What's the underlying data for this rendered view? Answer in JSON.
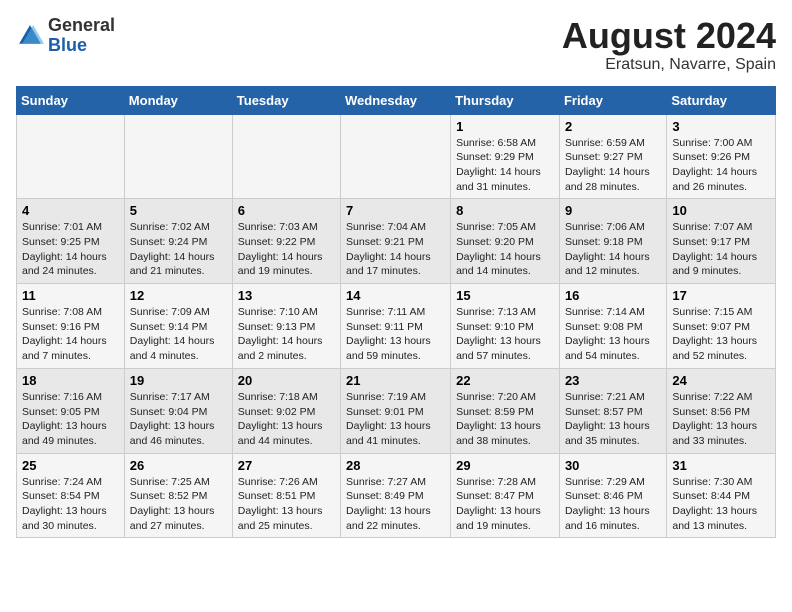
{
  "header": {
    "logo_general": "General",
    "logo_blue": "Blue",
    "month_year": "August 2024",
    "location": "Eratsun, Navarre, Spain"
  },
  "weekdays": [
    "Sunday",
    "Monday",
    "Tuesday",
    "Wednesday",
    "Thursday",
    "Friday",
    "Saturday"
  ],
  "weeks": [
    [
      {
        "day": "",
        "info": ""
      },
      {
        "day": "",
        "info": ""
      },
      {
        "day": "",
        "info": ""
      },
      {
        "day": "",
        "info": ""
      },
      {
        "day": "1",
        "info": "Sunrise: 6:58 AM\nSunset: 9:29 PM\nDaylight: 14 hours\nand 31 minutes."
      },
      {
        "day": "2",
        "info": "Sunrise: 6:59 AM\nSunset: 9:27 PM\nDaylight: 14 hours\nand 28 minutes."
      },
      {
        "day": "3",
        "info": "Sunrise: 7:00 AM\nSunset: 9:26 PM\nDaylight: 14 hours\nand 26 minutes."
      }
    ],
    [
      {
        "day": "4",
        "info": "Sunrise: 7:01 AM\nSunset: 9:25 PM\nDaylight: 14 hours\nand 24 minutes."
      },
      {
        "day": "5",
        "info": "Sunrise: 7:02 AM\nSunset: 9:24 PM\nDaylight: 14 hours\nand 21 minutes."
      },
      {
        "day": "6",
        "info": "Sunrise: 7:03 AM\nSunset: 9:22 PM\nDaylight: 14 hours\nand 19 minutes."
      },
      {
        "day": "7",
        "info": "Sunrise: 7:04 AM\nSunset: 9:21 PM\nDaylight: 14 hours\nand 17 minutes."
      },
      {
        "day": "8",
        "info": "Sunrise: 7:05 AM\nSunset: 9:20 PM\nDaylight: 14 hours\nand 14 minutes."
      },
      {
        "day": "9",
        "info": "Sunrise: 7:06 AM\nSunset: 9:18 PM\nDaylight: 14 hours\nand 12 minutes."
      },
      {
        "day": "10",
        "info": "Sunrise: 7:07 AM\nSunset: 9:17 PM\nDaylight: 14 hours\nand 9 minutes."
      }
    ],
    [
      {
        "day": "11",
        "info": "Sunrise: 7:08 AM\nSunset: 9:16 PM\nDaylight: 14 hours\nand 7 minutes."
      },
      {
        "day": "12",
        "info": "Sunrise: 7:09 AM\nSunset: 9:14 PM\nDaylight: 14 hours\nand 4 minutes."
      },
      {
        "day": "13",
        "info": "Sunrise: 7:10 AM\nSunset: 9:13 PM\nDaylight: 14 hours\nand 2 minutes."
      },
      {
        "day": "14",
        "info": "Sunrise: 7:11 AM\nSunset: 9:11 PM\nDaylight: 13 hours\nand 59 minutes."
      },
      {
        "day": "15",
        "info": "Sunrise: 7:13 AM\nSunset: 9:10 PM\nDaylight: 13 hours\nand 57 minutes."
      },
      {
        "day": "16",
        "info": "Sunrise: 7:14 AM\nSunset: 9:08 PM\nDaylight: 13 hours\nand 54 minutes."
      },
      {
        "day": "17",
        "info": "Sunrise: 7:15 AM\nSunset: 9:07 PM\nDaylight: 13 hours\nand 52 minutes."
      }
    ],
    [
      {
        "day": "18",
        "info": "Sunrise: 7:16 AM\nSunset: 9:05 PM\nDaylight: 13 hours\nand 49 minutes."
      },
      {
        "day": "19",
        "info": "Sunrise: 7:17 AM\nSunset: 9:04 PM\nDaylight: 13 hours\nand 46 minutes."
      },
      {
        "day": "20",
        "info": "Sunrise: 7:18 AM\nSunset: 9:02 PM\nDaylight: 13 hours\nand 44 minutes."
      },
      {
        "day": "21",
        "info": "Sunrise: 7:19 AM\nSunset: 9:01 PM\nDaylight: 13 hours\nand 41 minutes."
      },
      {
        "day": "22",
        "info": "Sunrise: 7:20 AM\nSunset: 8:59 PM\nDaylight: 13 hours\nand 38 minutes."
      },
      {
        "day": "23",
        "info": "Sunrise: 7:21 AM\nSunset: 8:57 PM\nDaylight: 13 hours\nand 35 minutes."
      },
      {
        "day": "24",
        "info": "Sunrise: 7:22 AM\nSunset: 8:56 PM\nDaylight: 13 hours\nand 33 minutes."
      }
    ],
    [
      {
        "day": "25",
        "info": "Sunrise: 7:24 AM\nSunset: 8:54 PM\nDaylight: 13 hours\nand 30 minutes."
      },
      {
        "day": "26",
        "info": "Sunrise: 7:25 AM\nSunset: 8:52 PM\nDaylight: 13 hours\nand 27 minutes."
      },
      {
        "day": "27",
        "info": "Sunrise: 7:26 AM\nSunset: 8:51 PM\nDaylight: 13 hours\nand 25 minutes."
      },
      {
        "day": "28",
        "info": "Sunrise: 7:27 AM\nSunset: 8:49 PM\nDaylight: 13 hours\nand 22 minutes."
      },
      {
        "day": "29",
        "info": "Sunrise: 7:28 AM\nSunset: 8:47 PM\nDaylight: 13 hours\nand 19 minutes."
      },
      {
        "day": "30",
        "info": "Sunrise: 7:29 AM\nSunset: 8:46 PM\nDaylight: 13 hours\nand 16 minutes."
      },
      {
        "day": "31",
        "info": "Sunrise: 7:30 AM\nSunset: 8:44 PM\nDaylight: 13 hours\nand 13 minutes."
      }
    ]
  ]
}
